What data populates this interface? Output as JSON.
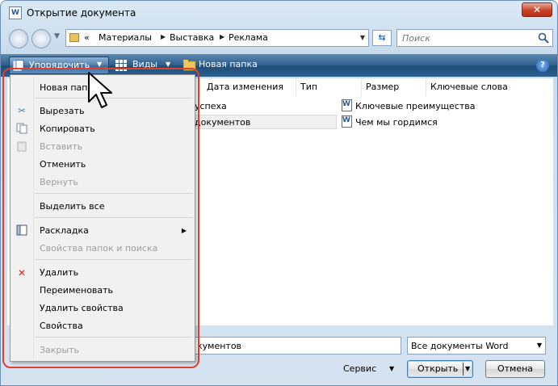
{
  "window": {
    "title": "Открытие документа"
  },
  "nav": {
    "breadcrumb": [
      "«",
      "Материалы",
      "Выставка",
      "Реклама"
    ],
    "search_placeholder": "Поиск"
  },
  "toolbar": {
    "organize_label": "Упорядочить",
    "views_label": "Виды",
    "new_folder_label": "Новая папка"
  },
  "columns": [
    "Дата изменения",
    "Тип",
    "Размер",
    "Ключевые слова"
  ],
  "files": [
    {
      "name": "успеха",
      "col": 0
    },
    {
      "name": "документов",
      "col": 0,
      "selected": true
    },
    {
      "name": "Ключевые преимущества",
      "col": 1
    },
    {
      "name": "Чем мы гордимся",
      "col": 1
    }
  ],
  "menu": {
    "items": [
      {
        "label": "Новая папка",
        "disabled": false
      },
      {
        "label": "Вырезать",
        "disabled": false,
        "icon": "scissors-icon"
      },
      {
        "label": "Копировать",
        "disabled": false,
        "icon": "copy-icon"
      },
      {
        "label": "Вставить",
        "disabled": true,
        "icon": "paste-icon"
      },
      {
        "label": "Отменить",
        "disabled": false
      },
      {
        "label": "Вернуть",
        "disabled": true
      },
      {
        "label": "Выделить все",
        "disabled": false
      },
      {
        "label": "Раскладка",
        "disabled": false,
        "icon": "layout-icon",
        "submenu": true
      },
      {
        "label": "Свойства папок и поиска",
        "disabled": true
      },
      {
        "label": "Удалить",
        "disabled": false,
        "icon": "delete-icon"
      },
      {
        "label": "Переименовать",
        "disabled": false
      },
      {
        "label": "Удалить свойства",
        "disabled": false
      },
      {
        "label": "Свойства",
        "disabled": false
      },
      {
        "label": "Закрыть",
        "disabled": true
      }
    ]
  },
  "bottom": {
    "filename_value": "кументов",
    "filetype_value": "Все документы Word",
    "service_label": "Сервис",
    "open_label": "Открыть",
    "cancel_label": "Отмена"
  },
  "colors": {
    "highlight": "#e0402a",
    "toolbar": "#2e5e8a",
    "close_button": "#c8432a"
  }
}
